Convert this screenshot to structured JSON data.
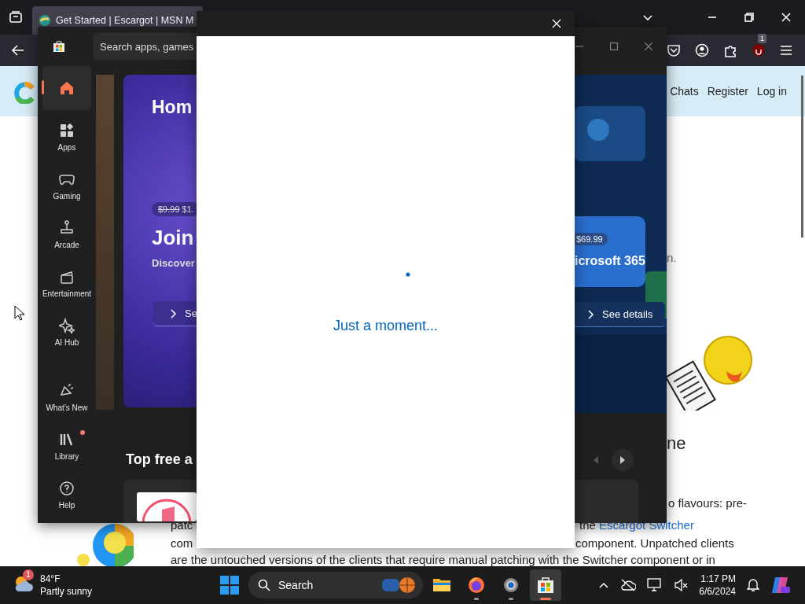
{
  "browser": {
    "tabs": [
      {
        "title": "Get Started | Escargot | MSN M",
        "selected": true
      }
    ],
    "toolbar": {
      "extension_badge": "1"
    },
    "page": {
      "nav_links": [
        "Chats",
        "Register",
        "Log in"
      ],
      "fragments": [
        {
          "text": "n."
        },
        {
          "text": "ne"
        },
        {
          "text": "o flavours: pre-"
        },
        {
          "text": "patc"
        },
        {
          "text": "com"
        },
        {
          "text": "component. Unpatched clients"
        },
        {
          "text": "are the untouched versions of the clients that require manual patching with the Switcher component or in"
        }
      ],
      "link_line": {
        "prefix": "the",
        "link": "Escargot Switcher"
      }
    }
  },
  "store": {
    "search": {
      "placeholder": "Search apps, games"
    },
    "nav": [
      {
        "selected": true,
        "badge": false
      },
      {
        "label": "Apps",
        "selected": false,
        "badge": false
      },
      {
        "label": "Gaming",
        "selected": false,
        "badge": false
      },
      {
        "label": "Arcade",
        "selected": false,
        "badge": false
      },
      {
        "label": "Entertainment",
        "selected": false,
        "badge": false
      },
      {
        "label": "AI Hub",
        "selected": false,
        "badge": false
      },
      {
        "label": "What’s New",
        "selected": false,
        "badge": false
      },
      {
        "label": "Library",
        "selected": false,
        "badge": true
      },
      {
        "label": "Help",
        "selected": false,
        "badge": false
      }
    ],
    "hero": {
      "title": "Hom",
      "old_price": "$9.99",
      "price": "$1.",
      "headline": "Join",
      "subtitle": "Discover",
      "button": "Se"
    },
    "promo": {
      "price": "$69.99",
      "title": "icrosoft 365",
      "button": "See details"
    },
    "section_title": "Top free a"
  },
  "dialog": {
    "message": "Just a moment..."
  },
  "taskbar": {
    "weather": {
      "badge": "1",
      "temperature": "84°F",
      "condition": "Partly sunny"
    },
    "search": {
      "placeholder": "Search"
    },
    "apps": [
      {
        "running": false,
        "selected": false
      },
      {
        "running": true,
        "selected": false
      },
      {
        "running": true,
        "selected": false
      },
      {
        "running": true,
        "selected": true
      }
    ],
    "clock": {
      "time": "1:17 PM",
      "date": "6/6/2024"
    }
  }
}
